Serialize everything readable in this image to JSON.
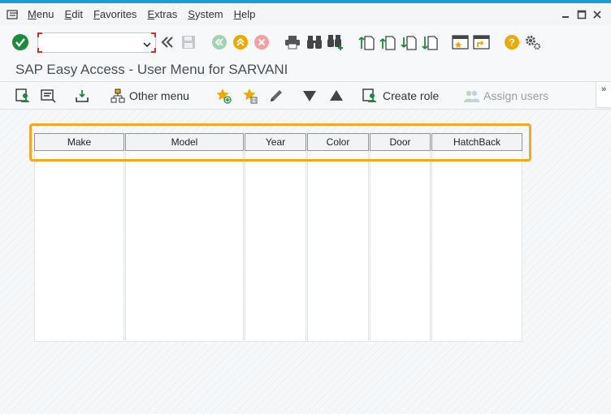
{
  "menubar": {
    "items": [
      {
        "label": "Menu",
        "underline": "M",
        "rest": "enu"
      },
      {
        "label": "Edit",
        "underline": "E",
        "rest": "dit"
      },
      {
        "label": "Favorites",
        "underline": "F",
        "rest": "avorites"
      },
      {
        "label": "Extras",
        "underline": "E",
        "rest": "xtras"
      },
      {
        "label": "System",
        "underline": "S",
        "rest": "ystem"
      },
      {
        "label": "Help",
        "underline": "H",
        "rest": "elp"
      }
    ]
  },
  "toolbar": {
    "command_field": {
      "value": "",
      "placeholder": ""
    }
  },
  "page": {
    "title": "SAP Easy Access  -  User Menu for SARVANI"
  },
  "app_toolbar": {
    "other_menu_label": "Other menu",
    "create_role_label": "Create role",
    "assign_users_label": "Assign users",
    "overflow_label": "»"
  },
  "table": {
    "columns": [
      "Make",
      "Model",
      "Year",
      "Color",
      "Door",
      "HatchBack"
    ],
    "rows": []
  },
  "colors": {
    "accent": "#1a9bd7",
    "highlight": "#f5a623",
    "success": "#1e8a3c"
  }
}
